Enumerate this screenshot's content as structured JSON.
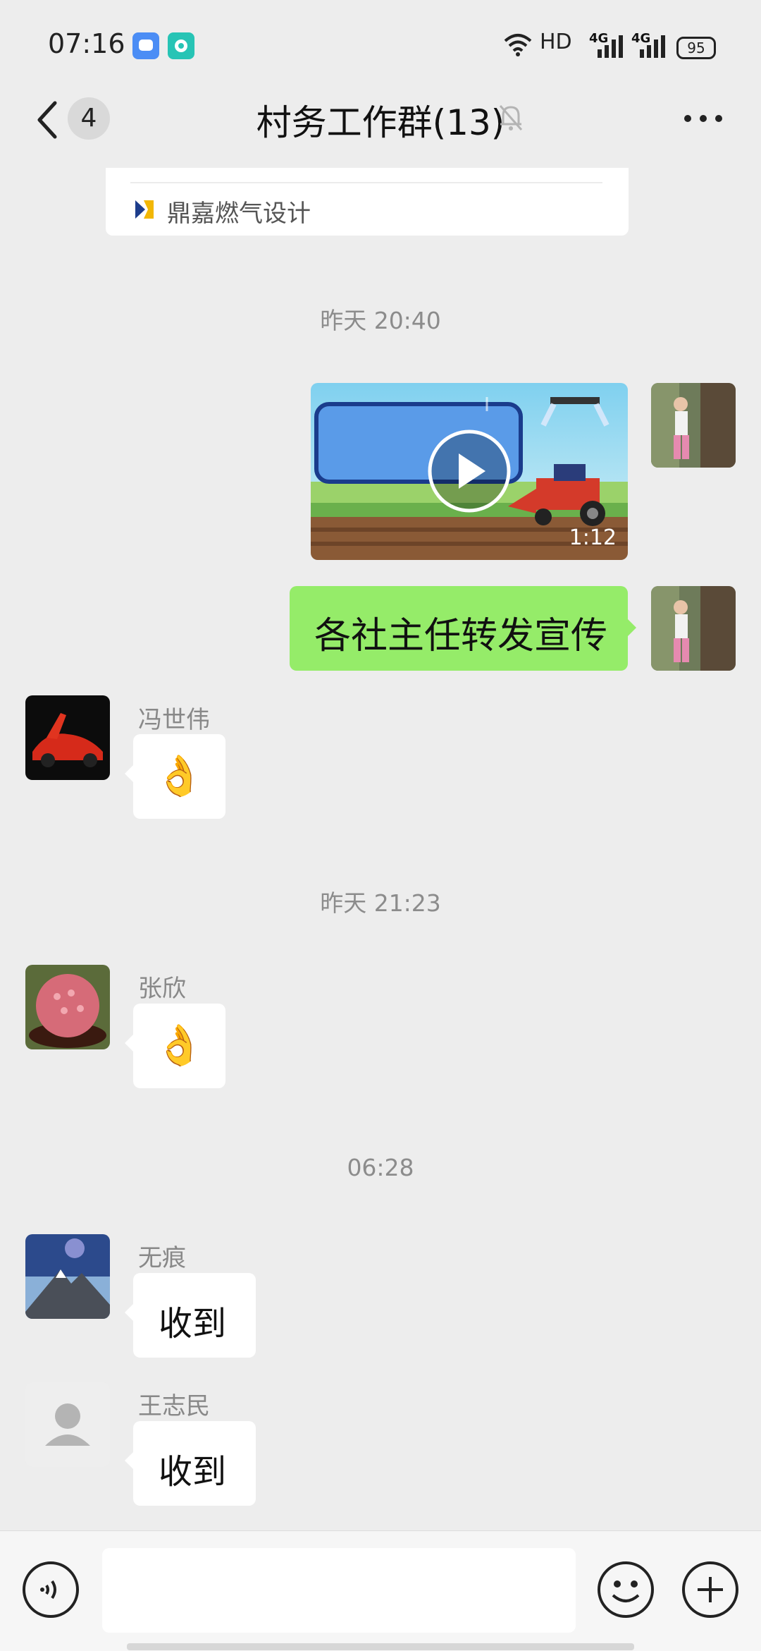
{
  "status_bar": {
    "time": "07:16",
    "network": "HD",
    "signal_1": "4G",
    "signal_2": "4G",
    "battery": "95"
  },
  "header": {
    "unread_count": "4",
    "title": "村务工作群(13)"
  },
  "link_card": {
    "source": "鼎嘉燃气设计"
  },
  "messages": {
    "time_1": "昨天 20:40",
    "video_duration": "1:12",
    "self_text": "各社主任转发宣传",
    "sender_1": "冯世伟",
    "emoji_1": "👌",
    "time_2": "昨天 21:23",
    "sender_2": "张欣",
    "emoji_2": "👌",
    "time_3": "06:28",
    "sender_3": "无痕",
    "text_3": "收到",
    "sender_4": "王志民",
    "text_4": "收到"
  },
  "input_bar": {
    "placeholder": ""
  },
  "colors": {
    "background": "#ededed",
    "self_bubble": "#95ec69",
    "other_bubble": "#ffffff"
  }
}
